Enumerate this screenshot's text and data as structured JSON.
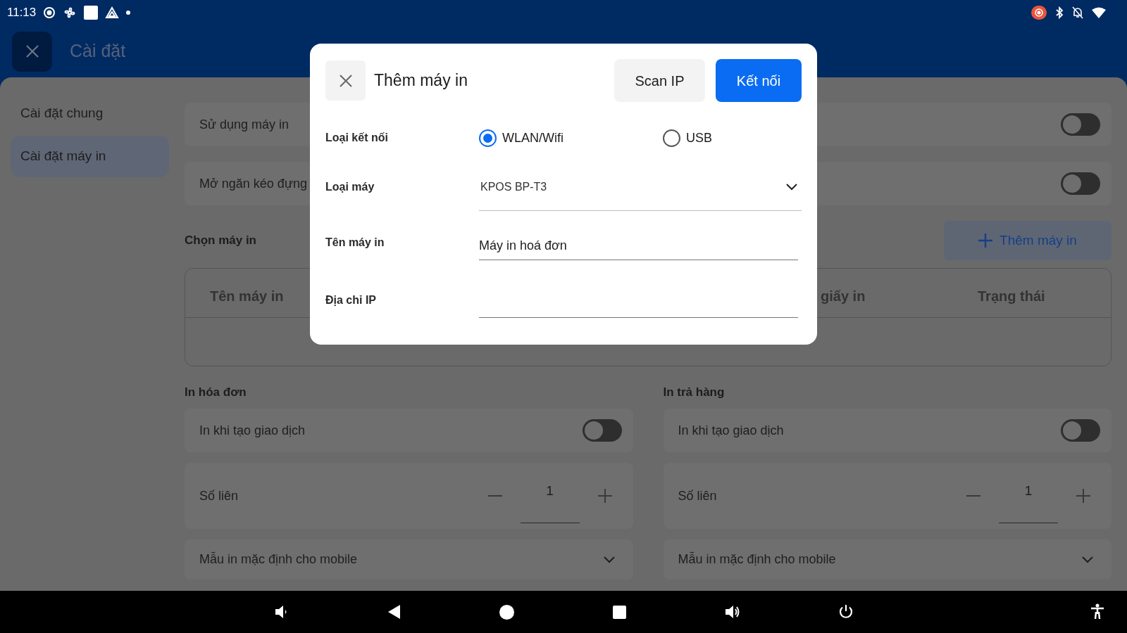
{
  "status_bar": {
    "time": "11:13"
  },
  "header": {
    "title": "Cài đặt"
  },
  "sidebar": {
    "items": [
      {
        "label": "Cài đặt chung",
        "selected": false
      },
      {
        "label": "Cài đặt máy in",
        "selected": true
      }
    ]
  },
  "settings": [
    {
      "label": "Sử dụng máy in",
      "on": false
    },
    {
      "label": "Mở ngăn kéo đựng",
      "on": false
    }
  ],
  "printers": {
    "title": "Chọn máy in",
    "add_button": "Thêm máy in",
    "columns": [
      "Tên máy in",
      "giấy in",
      "Trạng thái"
    ]
  },
  "print_sections": [
    {
      "title": "In hóa đơn",
      "auto_print": {
        "label": "In khi tạo giao dịch",
        "on": false
      },
      "copies": {
        "label": "Số liên",
        "value": "1"
      },
      "template": {
        "label": "Mẫu in mặc định cho mobile"
      }
    },
    {
      "title": "In trả hàng",
      "auto_print": {
        "label": "In khi tạo giao dịch",
        "on": false
      },
      "copies": {
        "label": "Số liên",
        "value": "1"
      },
      "template": {
        "label": "Mẫu in mặc định cho mobile"
      }
    }
  ],
  "dialog": {
    "title": "Thêm máy in",
    "scan_button": "Scan IP",
    "connect_button": "Kết nối",
    "fields": [
      {
        "kind": "radio",
        "label": "Loại kết nối",
        "options": [
          {
            "label": "WLAN/Wifi",
            "selected": true
          },
          {
            "label": "USB",
            "selected": false
          }
        ]
      },
      {
        "kind": "select",
        "label": "Loại máy",
        "value": "KPOS BP-T3"
      },
      {
        "kind": "text",
        "label": "Tên máy in",
        "value": "Máy in hoá đơn"
      },
      {
        "kind": "text",
        "label": "Địa chỉ IP"
      }
    ]
  }
}
